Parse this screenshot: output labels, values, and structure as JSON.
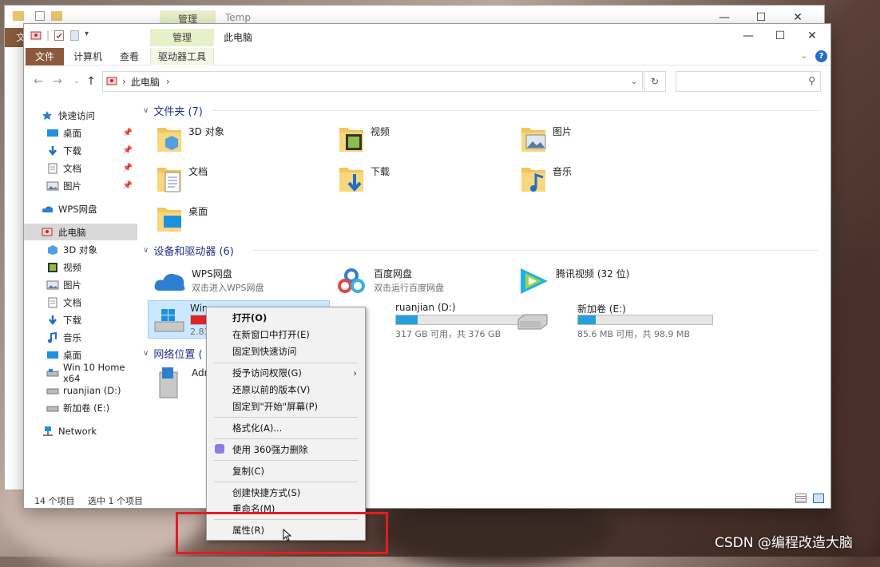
{
  "back_window": {
    "context_tab": "管理",
    "title": "Temp",
    "file_tab_partial": "文"
  },
  "window": {
    "title": "此电脑",
    "context_tab": "管理",
    "ribbon_tabs": [
      "文件",
      "计算机",
      "查看",
      "驱动器工具"
    ],
    "controls": {
      "minimize": "—",
      "maximize": "☐",
      "close": "✕"
    }
  },
  "address": {
    "path": "此电脑",
    "sep": "›"
  },
  "search": {
    "placeholder": ""
  },
  "sidebar": {
    "items": [
      {
        "label": "快速访问",
        "icon": "star-icon",
        "pinned": false
      },
      {
        "label": "桌面",
        "icon": "desktop-icon",
        "pinned": true
      },
      {
        "label": "下载",
        "icon": "download-icon",
        "pinned": true
      },
      {
        "label": "文档",
        "icon": "document-icon",
        "pinned": true
      },
      {
        "label": "图片",
        "icon": "pictures-icon",
        "pinned": true
      },
      {
        "label": "WPS网盘",
        "icon": "cloud-icon",
        "pinned": false
      },
      {
        "label": "此电脑",
        "icon": "computer-icon",
        "pinned": false
      },
      {
        "label": "3D 对象",
        "icon": "3d-objects-icon",
        "pinned": false
      },
      {
        "label": "视频",
        "icon": "video-icon",
        "pinned": false
      },
      {
        "label": "图片",
        "icon": "pictures-icon",
        "pinned": false
      },
      {
        "label": "文档",
        "icon": "document-icon",
        "pinned": false
      },
      {
        "label": "下载",
        "icon": "download-icon",
        "pinned": false
      },
      {
        "label": "音乐",
        "icon": "music-icon",
        "pinned": false
      },
      {
        "label": "桌面",
        "icon": "desktop-icon",
        "pinned": false
      },
      {
        "label": "Win 10 Home x64",
        "icon": "drive-icon",
        "pinned": false
      },
      {
        "label": "ruanjian (D:)",
        "icon": "drive-icon",
        "pinned": false
      },
      {
        "label": "新加卷 (E:)",
        "icon": "drive-icon",
        "pinned": false
      },
      {
        "label": "Network",
        "icon": "network-icon",
        "pinned": false
      }
    ]
  },
  "groups": {
    "folders": "文件夹 (7)",
    "devices": "设备和驱动器 (6)",
    "network": "网络位置 ("
  },
  "folders": [
    "3D 对象",
    "视频",
    "图片",
    "文档",
    "下载",
    "音乐",
    "桌面"
  ],
  "devices": [
    {
      "label": "WPS网盘",
      "sub": "双击进入WPS网盘"
    },
    {
      "label": "百度网盘",
      "sub": "双击运行百度网盘"
    },
    {
      "label": "腾讯视频 (32 位)",
      "sub": ""
    }
  ],
  "drives": [
    {
      "label": "Win 10 Home x64 (C:)",
      "label_visible": "Win",
      "sub": "2.81",
      "used_fraction": 0.95,
      "color": "#da2626"
    },
    {
      "label": "ruanjian (D:)",
      "sub": "317 GB 可用，共 376 GB",
      "used_fraction": 0.16,
      "color": "#26a0da"
    },
    {
      "label": "新加卷 (E:)",
      "sub": "85.6 MB 可用，共 98.9 MB",
      "used_fraction": 0.13,
      "color": "#26a0da"
    }
  ],
  "network_item": {
    "label": "Adm"
  },
  "status": {
    "count": "14 个项目",
    "selected": "选中 1 个项目"
  },
  "context_menu": {
    "items": [
      "打开(O)",
      "在新窗口中打开(E)",
      "固定到快速访问",
      "授予访问权限(G)",
      "还原以前的版本(V)",
      "固定到\"开始\"屏幕(P)",
      "格式化(A)...",
      "使用 360强力删除",
      "复制(C)",
      "创建快捷方式(S)",
      "重命名(M)",
      "属性(R)"
    ],
    "submenu_arrow": "›"
  },
  "watermark": "CSDN @编程改造大脑",
  "colors": {
    "file_tab": "#8b5a3c",
    "accent": "#26a0da",
    "highlight": "#e21b24",
    "context_tab": "#e7f0c8"
  }
}
